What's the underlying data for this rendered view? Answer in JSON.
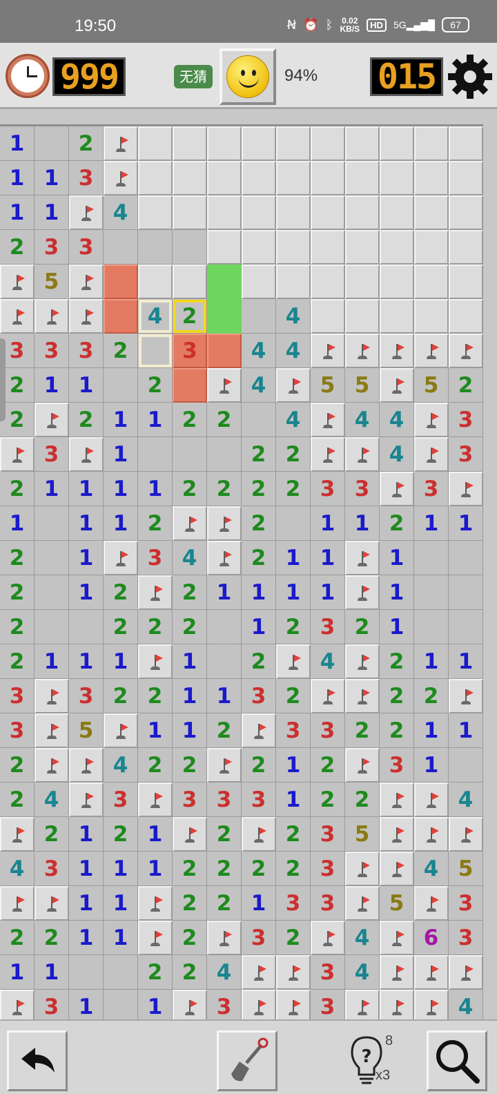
{
  "status_bar": {
    "time": "19:50",
    "network_speed": "0.02",
    "network_speed_unit": "KB/S",
    "hd_label": "HD",
    "signal_label": "5G",
    "battery": "67"
  },
  "toolbar": {
    "timer_value": "999",
    "no_guess_label": "无猜",
    "progress_percent": "94%",
    "mines_remaining": "015",
    "icons": [
      "clock-icon",
      "smiley-icon",
      "gear-icon"
    ]
  },
  "board": {
    "cols": 14,
    "rows": 26,
    "legend": "F = flag, . = unopened, _ = opened empty, R = red unopened, G = green safe, digits = opened number",
    "grid": [
      "1_2F..........",
      "113F..........",
      "11F4..........",
      "233___........",
      "F5FR..G.......",
      "FFFR42G_4.....",
      "3332_3R44FFFFF",
      "211_2RF4F55F52",
      "2F21122_4F44F3_",
      "F3F1___22FF4F31",
      "21111222233F3F1",
      "1_112FF2_11211",
      "2_1F34F211F1___",
      "2_12F21111F1___",
      "2__222_12321__",
      "2111F1_2F4F211",
      "3F3221132FF22F1",
      "3F5F112F332211",
      "2FF422F212F31_",
      "24F3F333122FF42",
      "F2121F2F235FFFF",
      "4311122223FF453",
      "FF11F22133F5F3F",
      "2211F2F32F4F63",
      "11__224FF34FFF",
      "F31_1F3FF3FFF4"
    ],
    "highlights": [
      {
        "row": 5,
        "col": 5,
        "color": "yellow"
      },
      {
        "row": 5,
        "col": 4,
        "color": "cream"
      },
      {
        "row": 6,
        "col": 4,
        "color": "cream"
      }
    ],
    "red_flag_cells": [
      [
        5,
        3
      ],
      [
        6,
        5
      ],
      [
        7,
        5
      ]
    ]
  },
  "bottom_bar": {
    "hint_count": "8",
    "hint_multiplier": "x3",
    "icons": [
      "undo-arrow-icon",
      "shovel-icon",
      "lightbulb-hint-icon",
      "magnifier-icon"
    ]
  },
  "colors": {
    "number_1": "#1a1acb",
    "number_2": "#1e8a1e",
    "number_3": "#cc2f2f",
    "number_4": "#19858f",
    "number_5": "#8a7a12",
    "number_6": "#a318a3",
    "lcd_digits": "#e8a020",
    "safe_highlight": "#6ed65e",
    "danger_highlight": "#e47a62"
  }
}
